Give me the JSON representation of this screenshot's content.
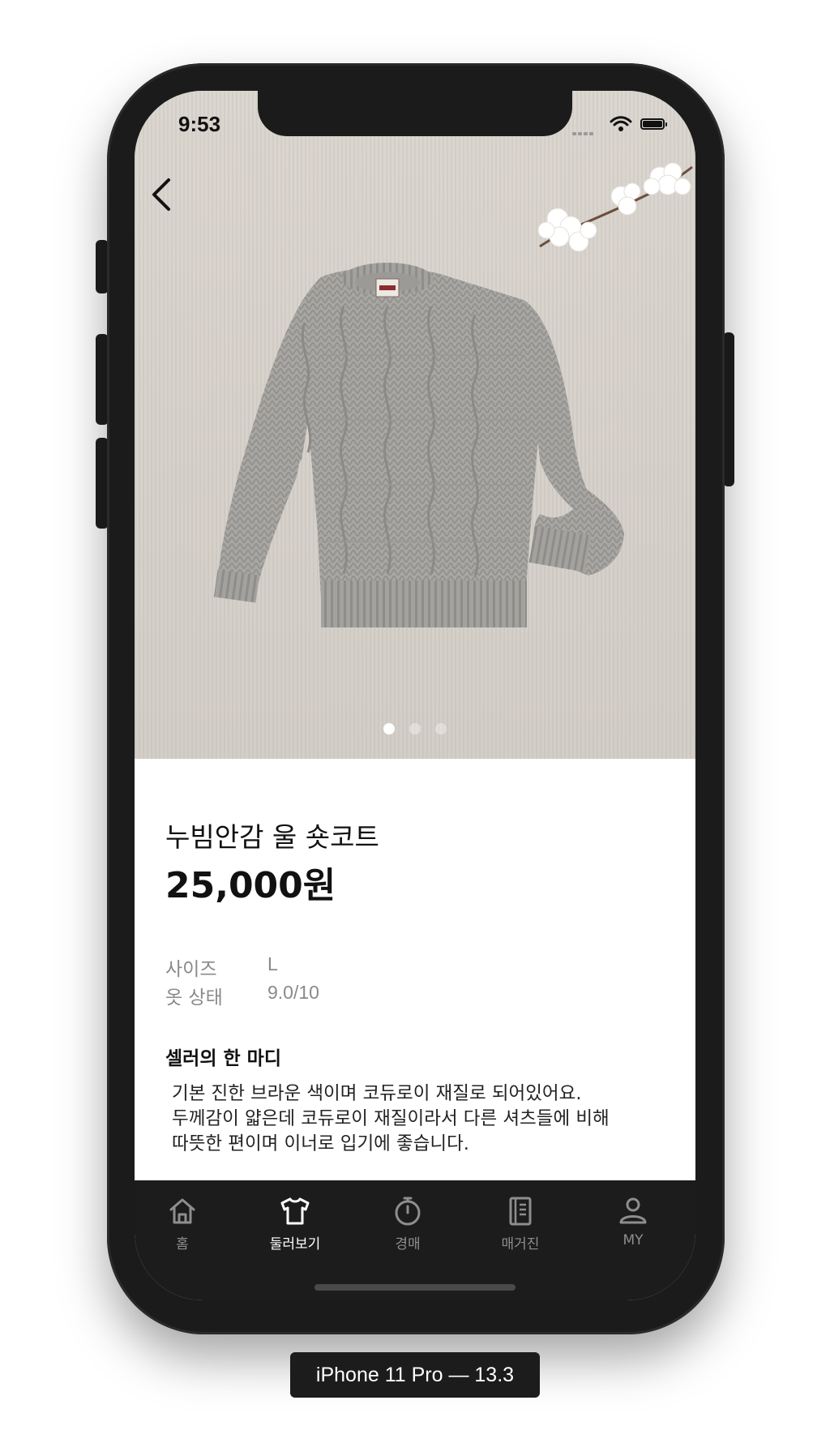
{
  "status_bar": {
    "time": "9:53"
  },
  "product": {
    "title": "누빔안감 울 숏코트",
    "price": "25,000원",
    "image_count": 3,
    "active_image_index": 0
  },
  "specs": [
    {
      "label": "사이즈",
      "value": "L"
    },
    {
      "label": "옷 상태",
      "value": "9.0/10"
    }
  ],
  "seller_note": {
    "heading": "셀러의 한 마디",
    "lines": [
      "기본 진한 브라운 색이며 코듀로이 재질로 되어있어요.",
      "두께감이 얇은데 코듀로이 재질이라서 다른 셔츠들에 비해",
      "따뜻한 편이며 이너로 입기에 좋습니다."
    ]
  },
  "tab_bar": {
    "active": "browse",
    "items": [
      {
        "id": "home",
        "label": "홈",
        "icon": "home-icon"
      },
      {
        "id": "browse",
        "label": "둘러보기",
        "icon": "tshirt-icon"
      },
      {
        "id": "auction",
        "label": "경매",
        "icon": "stopwatch-icon"
      },
      {
        "id": "magazine",
        "label": "매거진",
        "icon": "magazine-icon"
      },
      {
        "id": "my",
        "label": "MY",
        "icon": "person-icon"
      }
    ]
  },
  "device_label": "iPhone 11 Pro — 13.3",
  "colors": {
    "tab_bar_bg": "#1c1c1c",
    "tab_active": "#ffffff",
    "tab_inactive": "#8e8e8e",
    "hero_bg": "#d8d3cc",
    "text_primary": "#111111",
    "text_secondary": "#8a8a8a"
  }
}
